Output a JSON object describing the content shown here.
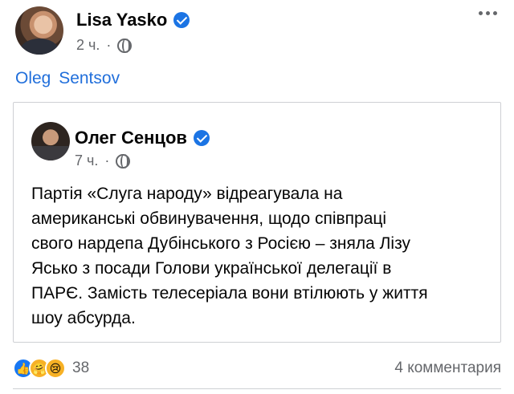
{
  "post": {
    "author": "Lisa Yasko",
    "time": "2 ч.",
    "separator": "·",
    "tagged": "Oleg  Sentsov"
  },
  "shared": {
    "author": "Олег Сенцов",
    "time": "7 ч.",
    "separator": "·",
    "text": "Партія «Слуга народу» відреагувала на\nамериканські обвинувачення, щодо співпраці\nсвого нардепа Дубінського з Росією – зняла Лізу\nЯсько з посади Голови української делегації в\nПАРЄ. Замість телесеріала вони втілюють у життя\nшоу абсурда."
  },
  "footer": {
    "reaction_count": "38",
    "comments": "4 комментария"
  },
  "icons": {
    "verified": "verified-badge-icon",
    "audience": "globe-icon",
    "more": "more-options-icon",
    "reactions": [
      "like-icon",
      "care-icon",
      "sad-icon"
    ]
  },
  "colors": {
    "accent": "#1b74e4",
    "link": "#216fdb",
    "secondary_text": "#65676b",
    "border": "#ced0d4"
  }
}
